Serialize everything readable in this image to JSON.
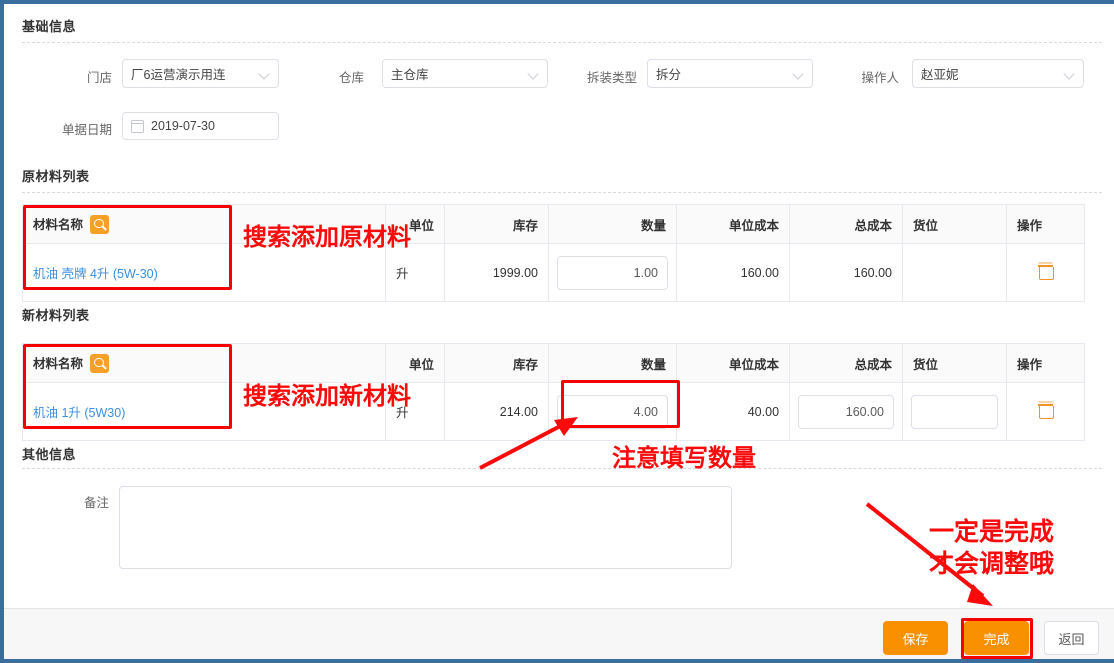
{
  "sections": {
    "basic": "基础信息",
    "raw_list": "原材料列表",
    "new_list": "新材料列表",
    "other": "其他信息"
  },
  "form": {
    "store_label": "门店",
    "store_value": "厂6运营演示用连",
    "warehouse_label": "仓库",
    "warehouse_value": "主仓库",
    "type_label": "拆装类型",
    "type_value": "拆分",
    "operator_label": "操作人",
    "operator_value": "赵亚妮",
    "date_label": "单据日期",
    "date_value": "2019-07-30"
  },
  "table_headers": {
    "name": "材料名称",
    "unit": "单位",
    "stock": "库存",
    "qty": "数量",
    "unit_cost": "单位成本",
    "total_cost": "总成本",
    "location": "货位",
    "action": "操作"
  },
  "raw_row": {
    "name": "机油 壳牌 4升 (5W-30)",
    "unit": "升",
    "stock": "1999.00",
    "qty": "1.00",
    "unit_cost": "160.00",
    "total_cost": "160.00",
    "location": ""
  },
  "new_row": {
    "name": "机油 1升 (5W30)",
    "unit": "升",
    "stock": "214.00",
    "qty": "4.00",
    "unit_cost": "40.00",
    "total_cost": "160.00",
    "location": ""
  },
  "other": {
    "note_label": "备注",
    "note_value": ""
  },
  "footer": {
    "save": "保存",
    "finish": "完成",
    "back": "返回"
  },
  "annotations": {
    "a1": "搜索添加原材料",
    "a2": "搜索添加新材料",
    "a3": "注意填写数量",
    "a4_line1": "一定是完成",
    "a4_line2": "才会调整哦"
  },
  "colors": {
    "accent_orange": "#f99000",
    "annotation_red": "#fa0a0a",
    "link_blue": "#3b8fe0",
    "frame_blue": "#3a6e9c"
  }
}
